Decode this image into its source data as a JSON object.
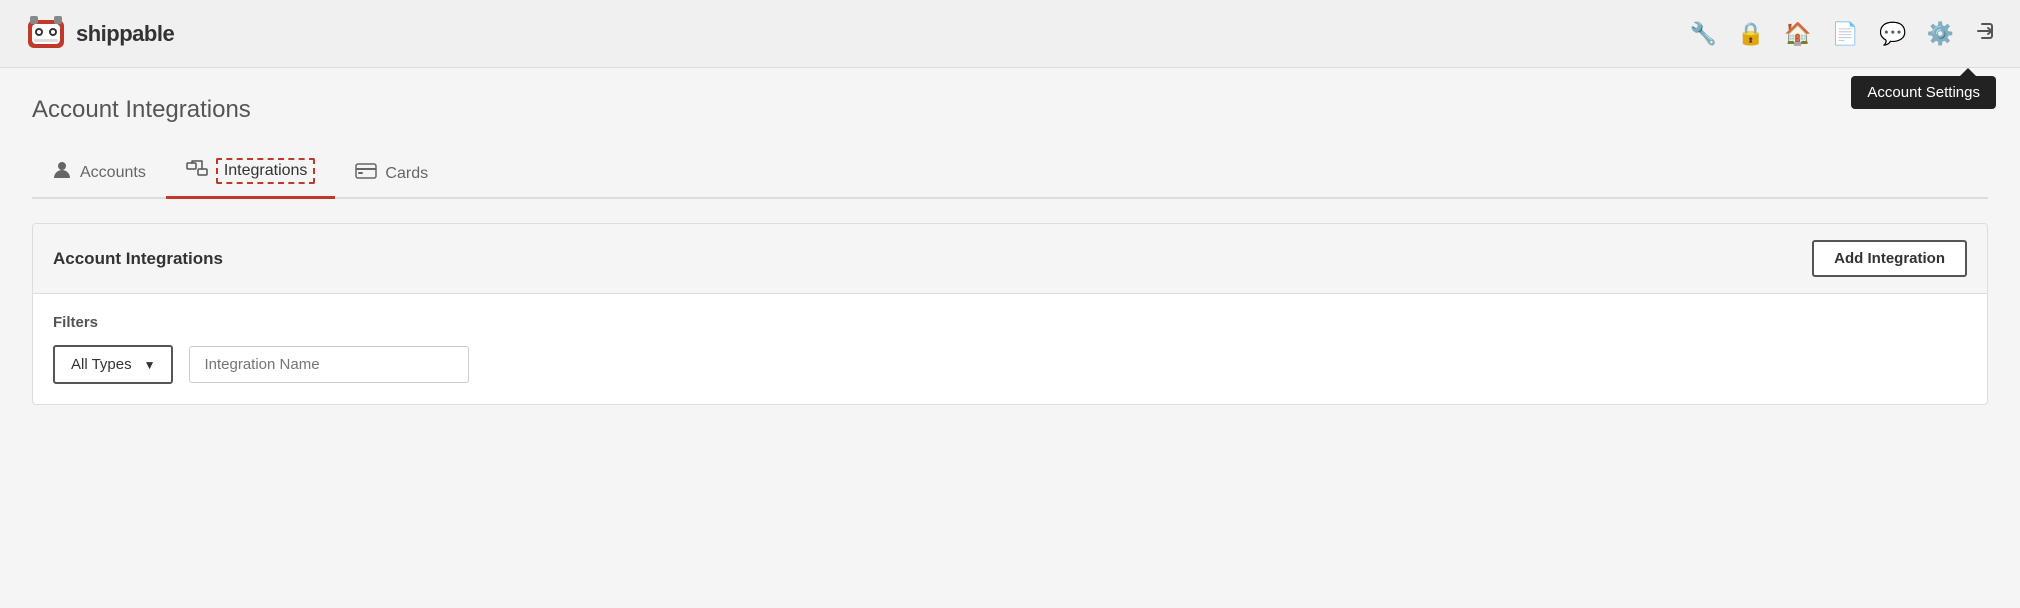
{
  "app": {
    "brand": "shippable",
    "logo_alt": "shippable logo"
  },
  "navbar": {
    "icons": [
      {
        "name": "wrench-icon",
        "symbol": "🔧"
      },
      {
        "name": "lock-icon",
        "symbol": "🔒"
      },
      {
        "name": "home-icon",
        "symbol": "🏠"
      },
      {
        "name": "document-icon",
        "symbol": "📋"
      },
      {
        "name": "chat-icon",
        "symbol": "💬"
      },
      {
        "name": "settings-icon",
        "symbol": "⚙"
      },
      {
        "name": "logout-icon",
        "symbol": "⏎"
      }
    ],
    "tooltip": "Account Settings"
  },
  "page": {
    "heading": "Account Integrations"
  },
  "tabs": [
    {
      "id": "accounts",
      "label": "Accounts",
      "icon": "👤",
      "active": false
    },
    {
      "id": "integrations",
      "label": "Integrations",
      "icon": "⇌",
      "active": true
    },
    {
      "id": "cards",
      "label": "Cards",
      "icon": "💳",
      "active": false
    }
  ],
  "panel": {
    "title": "Account Integrations",
    "add_button": "Add Integration",
    "filters_label": "Filters",
    "dropdown": {
      "label": "All Types",
      "caret": "▼"
    },
    "name_input_placeholder": "Integration Name"
  }
}
